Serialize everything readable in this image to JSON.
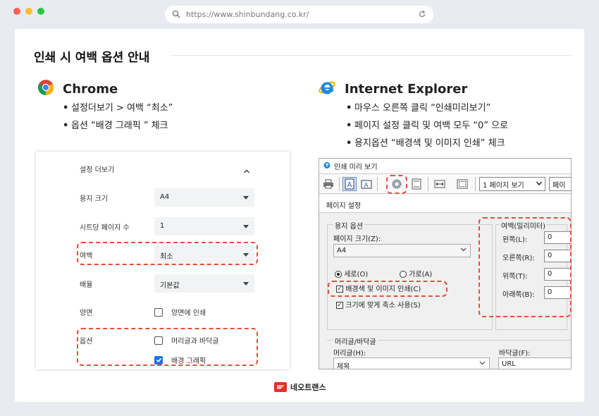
{
  "browser": {
    "url": "https://www.shinbundang.co.kr/",
    "colors": {
      "close": "#ff5f57",
      "minimize": "#febc2e",
      "zoom": "#28c840"
    }
  },
  "title": "인쇄 시 여백 옵션 안내",
  "chrome_section": {
    "name": "Chrome",
    "bullets": [
      "설정더보기 > 여백 “최소”",
      "옵션 “배경 그래픽 ”  체크"
    ],
    "panel": {
      "more_settings": "설정 더보기",
      "paper_size_label": "용지 크기",
      "paper_size_value": "A4",
      "pages_per_sheet_label": "시트당 페이지 수",
      "pages_per_sheet_value": "1",
      "margins_label": "여백",
      "margins_value": "최소",
      "scale_label": "배율",
      "scale_value": "기본값",
      "two_sided_label": "양면",
      "two_sided_option": "양면에 인쇄",
      "options_label": "옵션",
      "headers_footers_option": "머리글과 바닥글",
      "background_graphics_option": "배경 그래픽"
    }
  },
  "ie_section": {
    "name": "Internet Explorer",
    "bullets": [
      "마우스 오른쪽 클릭 “인쇄미리보기”",
      "페이지 설정 클릭 및 여백 모두 “0” 으로",
      "용지옵션 “배경색 및 이미지 인쇄” 체크"
    ],
    "window": {
      "title": "인쇄 미리 보기",
      "view_select": "1 페이지 보기",
      "view_select_2": "페이",
      "dialog_title": "페이지 설정",
      "paper_options": "용지 옵션",
      "page_size_label": "페이지 크기(Z):",
      "page_size_value": "A4",
      "portrait": "세로(O)",
      "landscape": "가로(A)",
      "print_bg": "배경색 및 이미지 인쇄(C)",
      "shrink_to_fit": "크기에 맞게 축소 사용(S)",
      "margins_title": "여백(밀리미터)",
      "left_label": "왼쪽(L):",
      "right_label": "오른쪽(R):",
      "top_label": "위쪽(T):",
      "bottom_label": "아래쪽(B):",
      "left_value": "0",
      "right_value": "0",
      "top_value": "0",
      "bottom_value": "0",
      "header_footer_title": "머리글/바닥글",
      "header_label": "머리글(H):",
      "header_value": "제목",
      "footer_label": "바닥글(F):",
      "footer_value": "URL"
    }
  },
  "footer": {
    "brand": "네오트랜스"
  },
  "accent": {
    "highlight_dash": "#e3503b",
    "check_blue": "#1a73e8",
    "ie_blue": "#1e88e5"
  }
}
